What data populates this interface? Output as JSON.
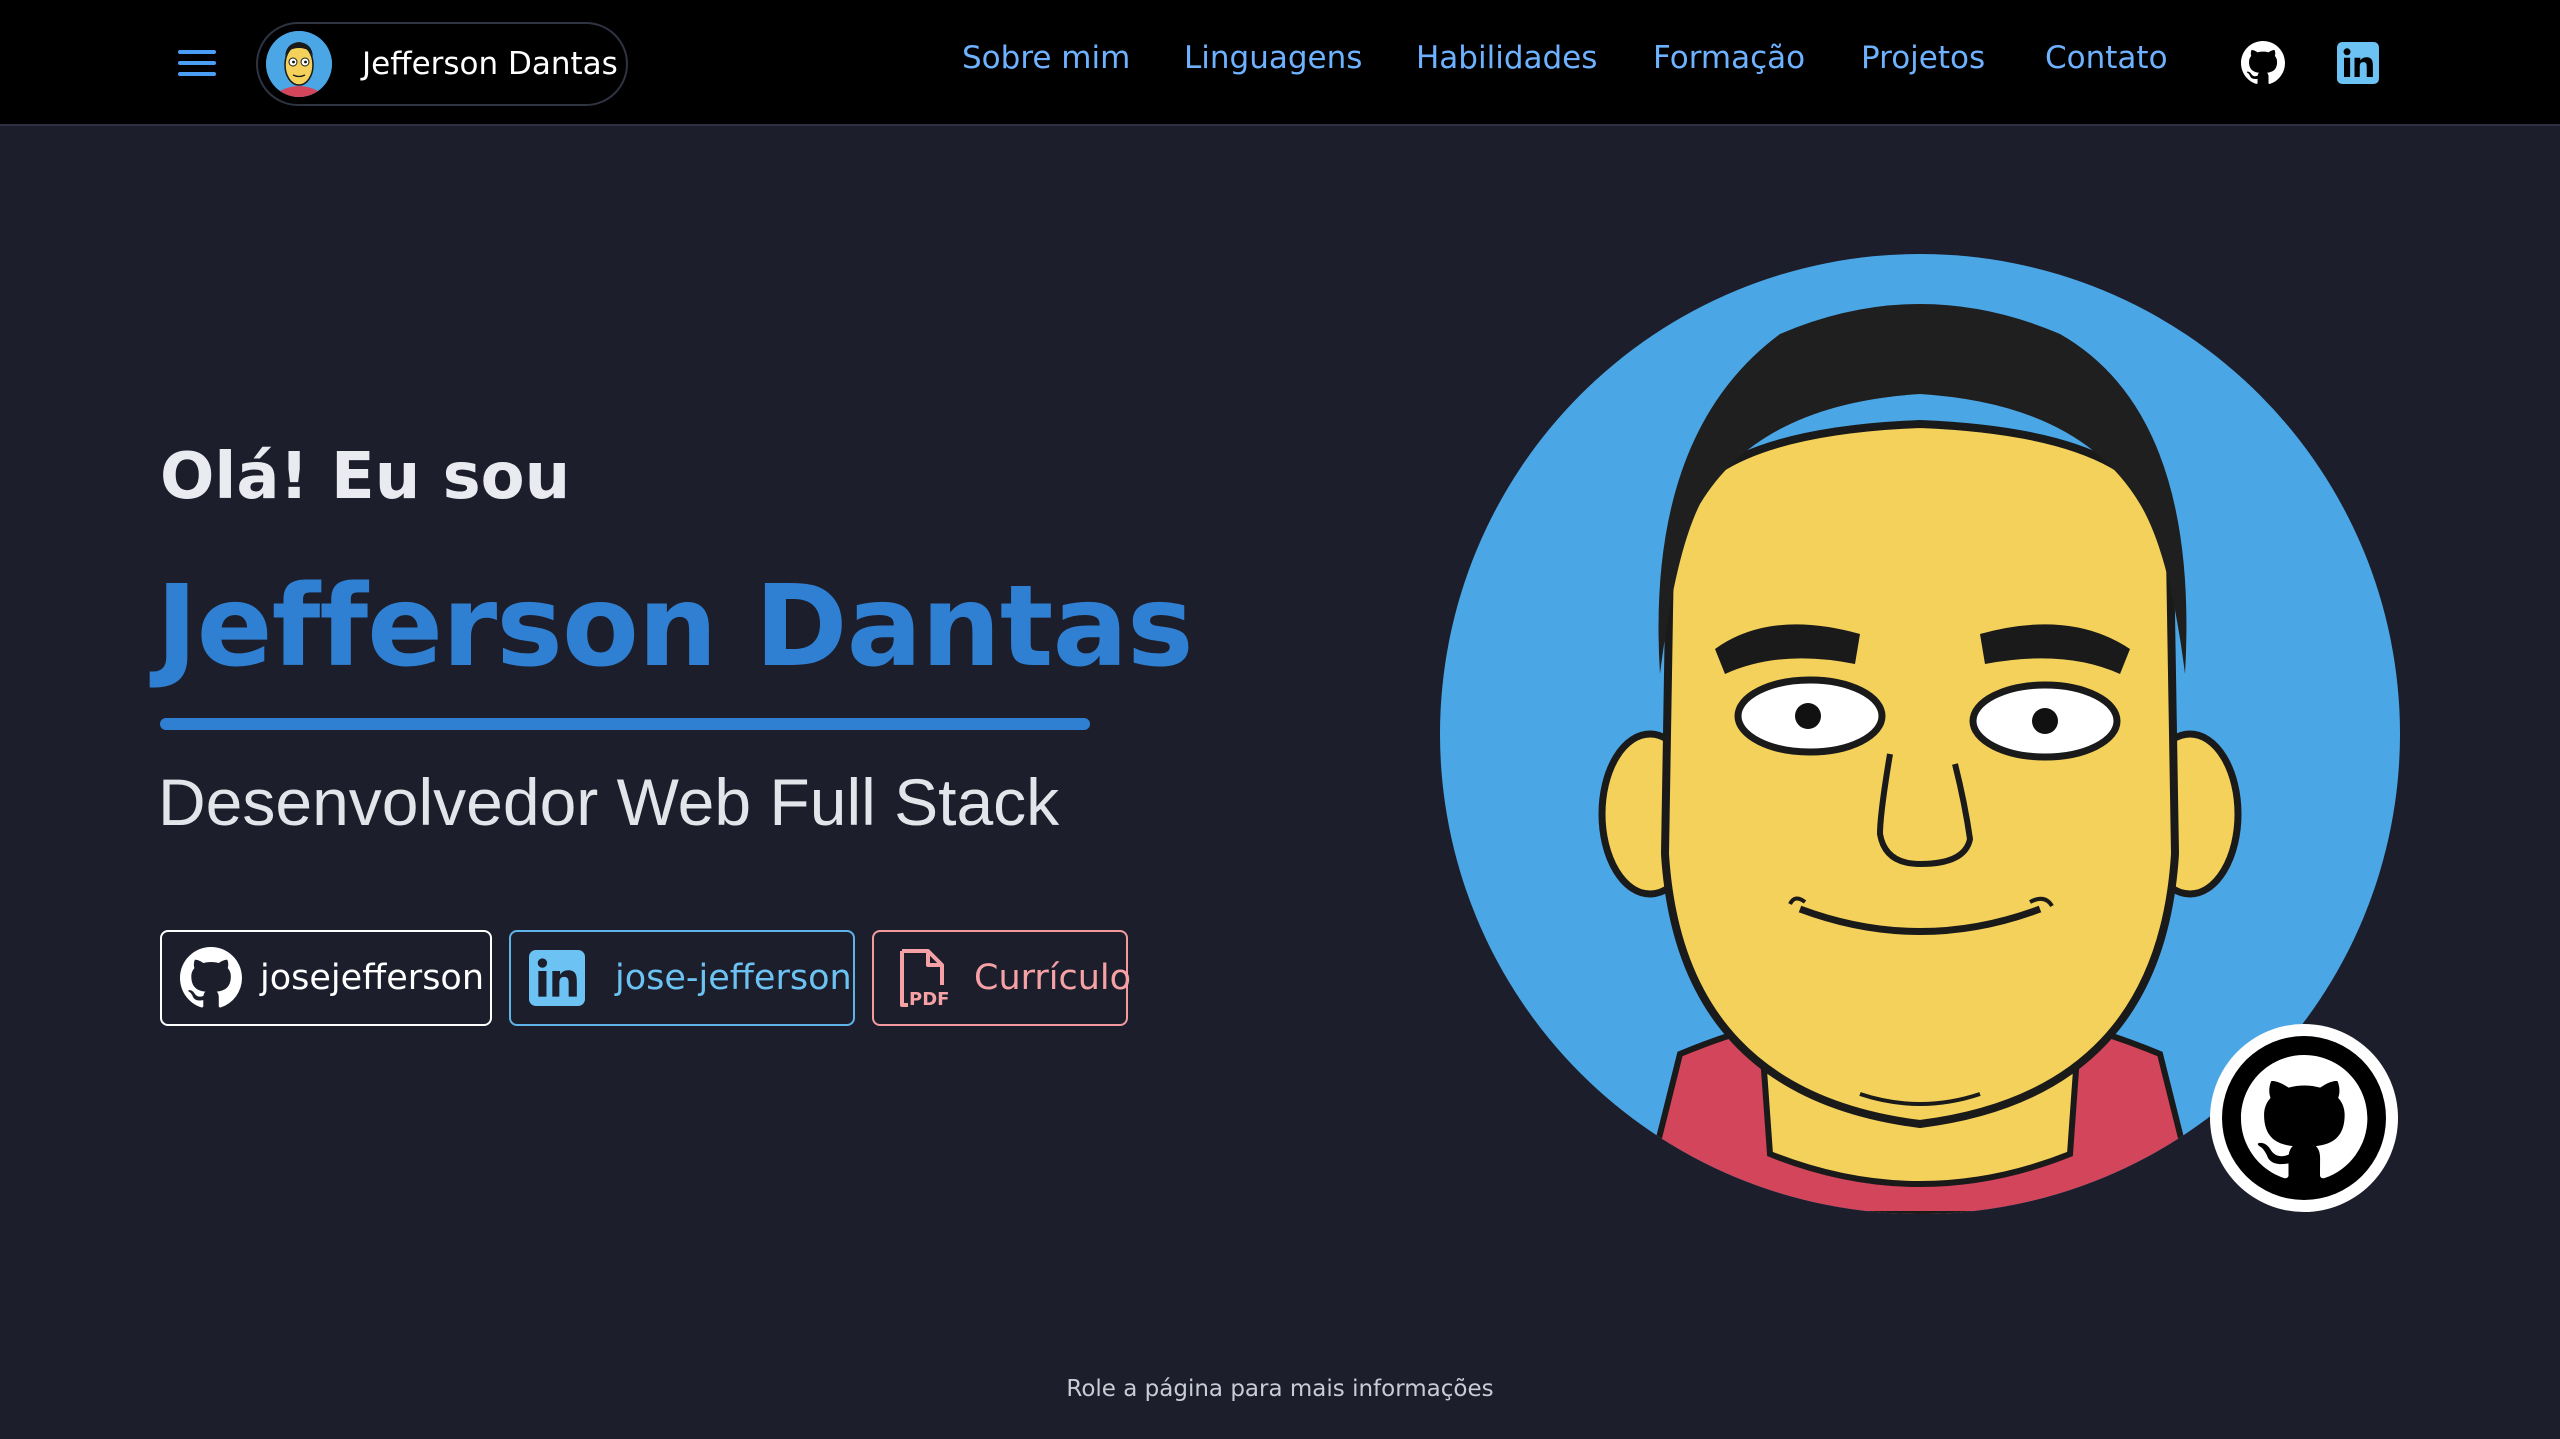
{
  "header": {
    "brand_name": "Jefferson Dantas",
    "nav": [
      {
        "label": "Sobre mim"
      },
      {
        "label": "Linguagens"
      },
      {
        "label": "Habilidades"
      },
      {
        "label": "Formação"
      },
      {
        "label": "Projetos"
      },
      {
        "label": "Contato"
      }
    ],
    "icons": [
      "menu-icon",
      "github-icon",
      "linkedin-icon"
    ]
  },
  "hero": {
    "greeting": "Olá! Eu sou",
    "name": "Jefferson Dantas",
    "role": "Desenvolvedor Web Full Stack",
    "buttons": {
      "github": {
        "label": "josejefferson",
        "icon": "github-icon"
      },
      "linkedin": {
        "label": "jose-jefferson",
        "icon": "linkedin-icon"
      },
      "resume": {
        "label": "Currículo",
        "icon": "pdf-file-icon",
        "icon_text": "PDF"
      }
    },
    "portrait_icon": "github-icon"
  },
  "footer": {
    "scroll_hint": "Role a página para mais informações"
  },
  "colors": {
    "background": "#1c1f2b",
    "header": "#000000",
    "accent": "#2f7fd3",
    "nav_link": "#6eb2ff",
    "linkedin": "#6cc3f3",
    "resume": "#f6a1a6",
    "avatar_bg": "#4ba6e6"
  }
}
